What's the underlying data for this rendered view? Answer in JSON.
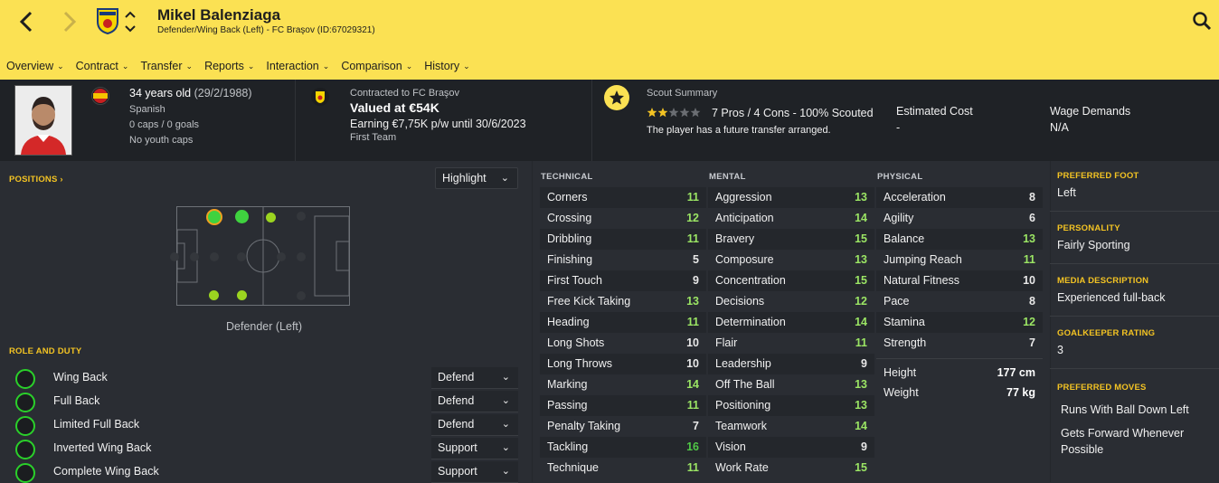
{
  "header": {
    "player_name": "Mikel Balenziaga",
    "subtitle": "Defender/Wing Back (Left) - FC Braşov (ID:67029321)",
    "club_badge_text": "BRAŞOV",
    "tabs": [
      {
        "label": "Overview"
      },
      {
        "label": "Contract"
      },
      {
        "label": "Transfer"
      },
      {
        "label": "Reports"
      },
      {
        "label": "Interaction"
      },
      {
        "label": "Comparison"
      },
      {
        "label": "History"
      }
    ],
    "accent": "#fbe153"
  },
  "profile": {
    "age": "34 years old",
    "dob": "(29/2/1988)",
    "nationality": "Spanish",
    "caps": "0 caps / 0 goals",
    "youth": "No youth caps"
  },
  "contract": {
    "club": "Contracted to FC Braşov",
    "value": "Valued at €54K",
    "earning": "Earning €7,75K p/w until 30/6/2023",
    "squad": "First Team"
  },
  "scout": {
    "title": "Scout Summary",
    "stars": 2,
    "stars_total": 5,
    "summary": "7 Pros / 4 Cons - 100% Scouted",
    "note": "The player has a future transfer arranged.",
    "est_cost_label": "Estimated Cost",
    "est_cost_value": "-",
    "wage_label": "Wage Demands",
    "wage_value": "N/A"
  },
  "positions": {
    "label": "POSITIONS",
    "view_select": "Highlight",
    "position_label": "Defender (Left)"
  },
  "roles": {
    "label": "ROLE AND DUTY",
    "items": [
      {
        "name": "Wing Back",
        "duty": "Defend"
      },
      {
        "name": "Full Back",
        "duty": "Defend"
      },
      {
        "name": "Limited Full Back",
        "duty": "Defend"
      },
      {
        "name": "Inverted Wing Back",
        "duty": "Support"
      },
      {
        "name": "Complete Wing Back",
        "duty": "Support"
      }
    ]
  },
  "technical": {
    "label": "TECHNICAL",
    "items": [
      {
        "name": "Corners",
        "value": "11"
      },
      {
        "name": "Crossing",
        "value": "12"
      },
      {
        "name": "Dribbling",
        "value": "11"
      },
      {
        "name": "Finishing",
        "value": "5"
      },
      {
        "name": "First Touch",
        "value": "9"
      },
      {
        "name": "Free Kick Taking",
        "value": "13"
      },
      {
        "name": "Heading",
        "value": "11"
      },
      {
        "name": "Long Shots",
        "value": "10"
      },
      {
        "name": "Long Throws",
        "value": "10"
      },
      {
        "name": "Marking",
        "value": "14"
      },
      {
        "name": "Passing",
        "value": "11"
      },
      {
        "name": "Penalty Taking",
        "value": "7"
      },
      {
        "name": "Tackling",
        "value": "16"
      },
      {
        "name": "Technique",
        "value": "11"
      }
    ]
  },
  "mental": {
    "label": "MENTAL",
    "items": [
      {
        "name": "Aggression",
        "value": "13"
      },
      {
        "name": "Anticipation",
        "value": "14"
      },
      {
        "name": "Bravery",
        "value": "15"
      },
      {
        "name": "Composure",
        "value": "13"
      },
      {
        "name": "Concentration",
        "value": "15"
      },
      {
        "name": "Decisions",
        "value": "12"
      },
      {
        "name": "Determination",
        "value": "14"
      },
      {
        "name": "Flair",
        "value": "11"
      },
      {
        "name": "Leadership",
        "value": "9"
      },
      {
        "name": "Off The Ball",
        "value": "13"
      },
      {
        "name": "Positioning",
        "value": "13"
      },
      {
        "name": "Teamwork",
        "value": "14"
      },
      {
        "name": "Vision",
        "value": "9"
      },
      {
        "name": "Work Rate",
        "value": "15"
      }
    ]
  },
  "physical": {
    "label": "PHYSICAL",
    "items": [
      {
        "name": "Acceleration",
        "value": "8"
      },
      {
        "name": "Agility",
        "value": "6"
      },
      {
        "name": "Balance",
        "value": "13"
      },
      {
        "name": "Jumping Reach",
        "value": "11"
      },
      {
        "name": "Natural Fitness",
        "value": "10"
      },
      {
        "name": "Pace",
        "value": "8"
      },
      {
        "name": "Stamina",
        "value": "12"
      },
      {
        "name": "Strength",
        "value": "7"
      }
    ],
    "height_label": "Height",
    "height_value": "177 cm",
    "weight_label": "Weight",
    "weight_value": "77 kg"
  },
  "details": {
    "foot_label": "PREFERRED FOOT",
    "foot_value": "Left",
    "personality_label": "PERSONALITY",
    "personality_value": "Fairly Sporting",
    "media_label": "MEDIA DESCRIPTION",
    "media_value": "Experienced full-back",
    "gk_label": "GOALKEEPER RATING",
    "gk_value": "3",
    "moves_label": "PREFERRED MOVES",
    "moves": [
      "Runs With Ball Down Left",
      "Gets Forward Whenever Possible"
    ]
  },
  "colors": {
    "attr_green": "#9be564",
    "attr_dark_green": "#50c846",
    "attr_white": "#e8e8e8",
    "label_yellow": "#f3c323"
  }
}
